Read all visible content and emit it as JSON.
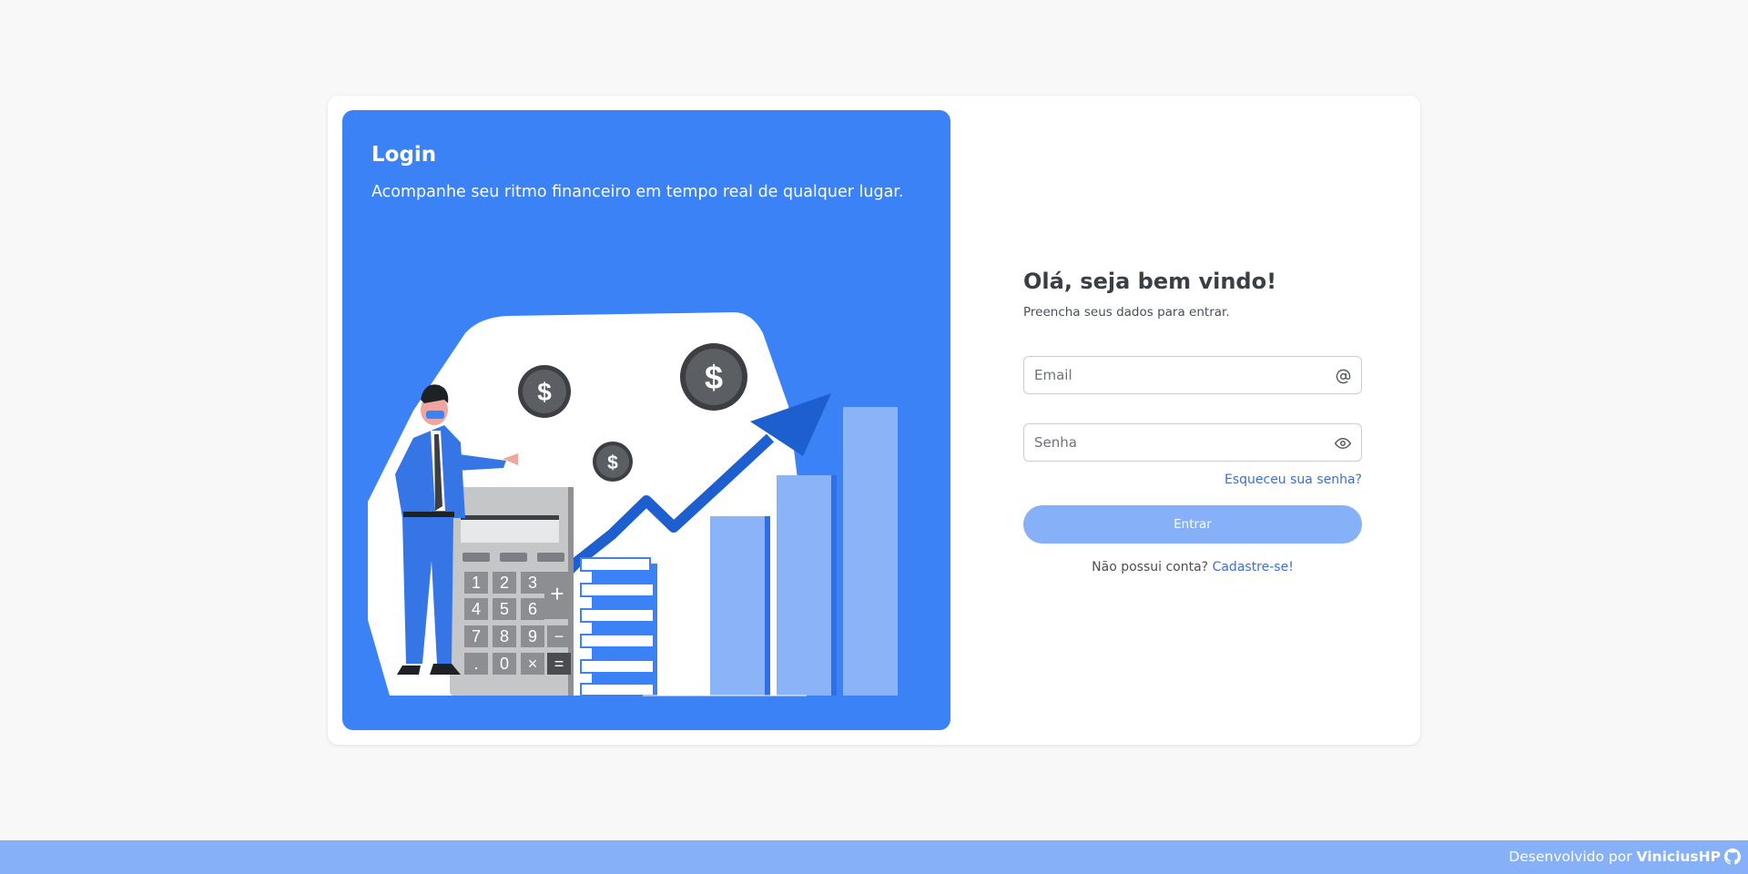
{
  "hero": {
    "title": "Login",
    "subtitle": "Acompanhe seu ritmo financeiro em tempo real de qualquer lugar.",
    "illustration": {
      "coin_symbol": "$",
      "calculator_keys": [
        "1",
        "2",
        "3",
        "+",
        "4",
        "5",
        "6",
        "7",
        "8",
        "9",
        "−",
        ".",
        "0",
        "×",
        "="
      ]
    }
  },
  "form": {
    "welcome_title": "Olá, seja bem vindo!",
    "welcome_subtitle": "Preencha seus dados para entrar.",
    "email": {
      "placeholder": "Email",
      "value": "",
      "icon": "at-sign-icon"
    },
    "password": {
      "placeholder": "Senha",
      "value": "",
      "icon": "eye-icon"
    },
    "forgot_label": "Esqueceu sua senha?",
    "submit_label": "Entrar",
    "signup_prompt": "Não possui conta?",
    "signup_link": "Cadastre-se!"
  },
  "footer": {
    "prefix": "Desenvolvido por",
    "author": "ViniciusHP",
    "icon": "github-icon"
  },
  "colors": {
    "background": "#f8f8f8",
    "hero_blue": "#3b82f6",
    "button_blue": "#86b0f8",
    "link_blue": "#3b6fd8",
    "footer_blue": "#86b0f8"
  }
}
